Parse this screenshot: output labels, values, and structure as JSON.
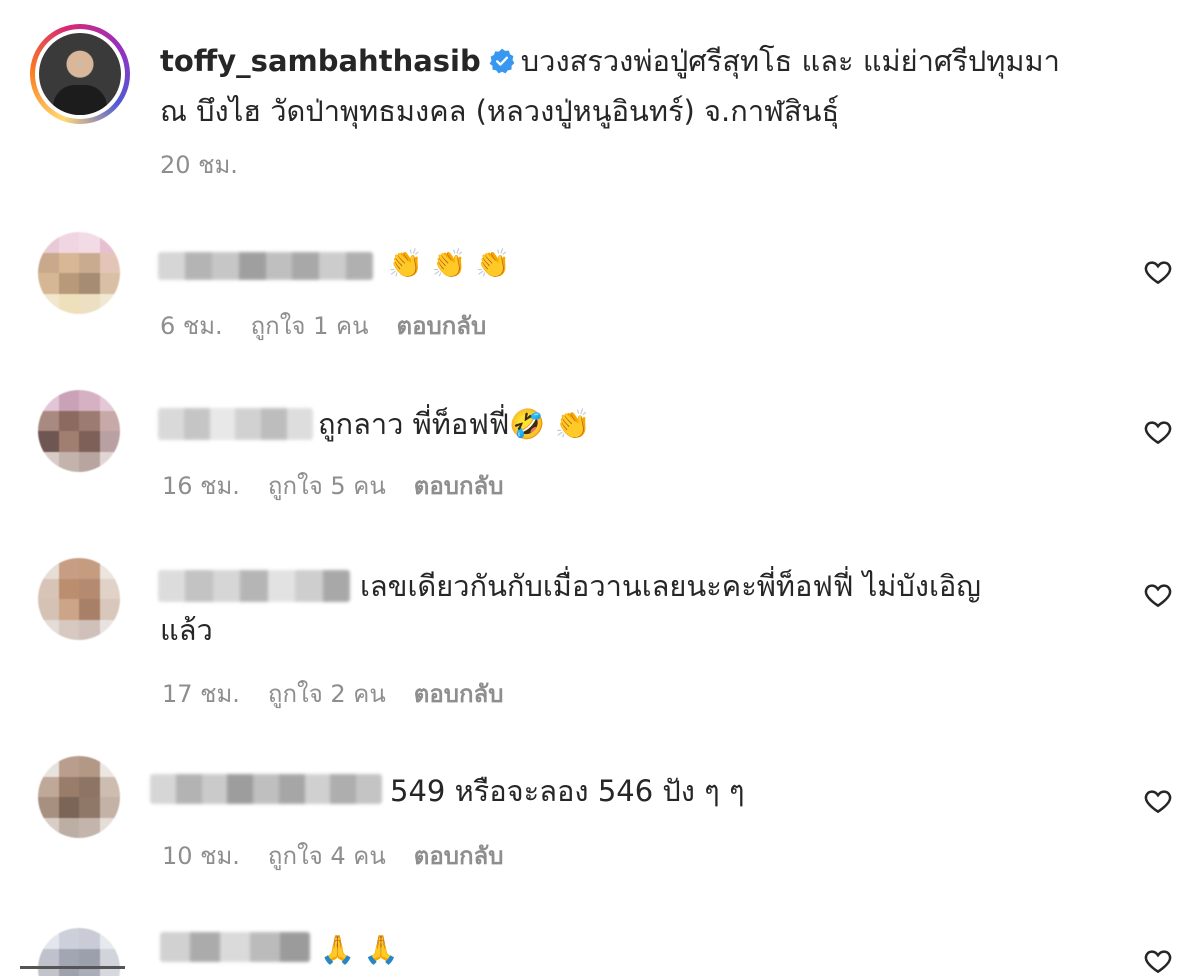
{
  "post": {
    "username": "toffy_sambahthasib",
    "caption_line1": "บวงสรวงพ่อปู่ศรีสุทโธ และ แม่ย่าศรีปทุมมา",
    "caption_line2": "ณ บึงไฮ วัดป่าพุทธมงคล (หลวงปู่หนูอินทร์) จ.กาฬสินธุ์",
    "time": "20 ชม."
  },
  "comments": [
    {
      "text": "👏 👏 👏",
      "time": "6 ชม.",
      "likes": "ถูกใจ 1 คน",
      "reply": "ตอบกลับ"
    },
    {
      "text": "ถูกลาว พี่ท็อฟฟี่🤣 👏",
      "time": "16 ชม.",
      "likes": "ถูกใจ 5 คน",
      "reply": "ตอบกลับ"
    },
    {
      "text": "เลขเดียวกันกับเมื่อวานเลยนะคะพี่ท็อฟฟี่ ไม่บังเอิญ",
      "text2": "แล้ว",
      "time": "17 ชม.",
      "likes": "ถูกใจ 2 คน",
      "reply": "ตอบกลับ"
    },
    {
      "text": "549 หรือจะลอง 546 ปัง ๆ ๆ",
      "time": "10 ชม.",
      "likes": "ถูกใจ 4 คน",
      "reply": "ตอบกลับ"
    },
    {
      "text": "🙏 🙏"
    }
  ],
  "colors": {
    "text": "#262626",
    "muted": "#8e8e8e",
    "verified": "#3897f0"
  },
  "icons": {
    "verified": "verified-badge-icon",
    "like": "heart-outline-icon"
  }
}
